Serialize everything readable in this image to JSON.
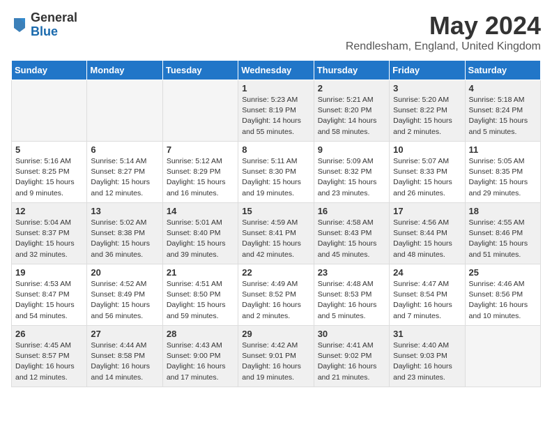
{
  "header": {
    "logo_general": "General",
    "logo_blue": "Blue",
    "title": "May 2024",
    "location": "Rendlesham, England, United Kingdom"
  },
  "weekdays": [
    "Sunday",
    "Monday",
    "Tuesday",
    "Wednesday",
    "Thursday",
    "Friday",
    "Saturday"
  ],
  "weeks": [
    [
      {
        "day": "",
        "empty": true
      },
      {
        "day": "",
        "empty": true
      },
      {
        "day": "",
        "empty": true
      },
      {
        "day": "1",
        "info": "Sunrise: 5:23 AM\nSunset: 8:19 PM\nDaylight: 14 hours\nand 55 minutes."
      },
      {
        "day": "2",
        "info": "Sunrise: 5:21 AM\nSunset: 8:20 PM\nDaylight: 14 hours\nand 58 minutes."
      },
      {
        "day": "3",
        "info": "Sunrise: 5:20 AM\nSunset: 8:22 PM\nDaylight: 15 hours\nand 2 minutes."
      },
      {
        "day": "4",
        "info": "Sunrise: 5:18 AM\nSunset: 8:24 PM\nDaylight: 15 hours\nand 5 minutes."
      }
    ],
    [
      {
        "day": "5",
        "info": "Sunrise: 5:16 AM\nSunset: 8:25 PM\nDaylight: 15 hours\nand 9 minutes."
      },
      {
        "day": "6",
        "info": "Sunrise: 5:14 AM\nSunset: 8:27 PM\nDaylight: 15 hours\nand 12 minutes."
      },
      {
        "day": "7",
        "info": "Sunrise: 5:12 AM\nSunset: 8:29 PM\nDaylight: 15 hours\nand 16 minutes."
      },
      {
        "day": "8",
        "info": "Sunrise: 5:11 AM\nSunset: 8:30 PM\nDaylight: 15 hours\nand 19 minutes."
      },
      {
        "day": "9",
        "info": "Sunrise: 5:09 AM\nSunset: 8:32 PM\nDaylight: 15 hours\nand 23 minutes."
      },
      {
        "day": "10",
        "info": "Sunrise: 5:07 AM\nSunset: 8:33 PM\nDaylight: 15 hours\nand 26 minutes."
      },
      {
        "day": "11",
        "info": "Sunrise: 5:05 AM\nSunset: 8:35 PM\nDaylight: 15 hours\nand 29 minutes."
      }
    ],
    [
      {
        "day": "12",
        "info": "Sunrise: 5:04 AM\nSunset: 8:37 PM\nDaylight: 15 hours\nand 32 minutes."
      },
      {
        "day": "13",
        "info": "Sunrise: 5:02 AM\nSunset: 8:38 PM\nDaylight: 15 hours\nand 36 minutes."
      },
      {
        "day": "14",
        "info": "Sunrise: 5:01 AM\nSunset: 8:40 PM\nDaylight: 15 hours\nand 39 minutes."
      },
      {
        "day": "15",
        "info": "Sunrise: 4:59 AM\nSunset: 8:41 PM\nDaylight: 15 hours\nand 42 minutes."
      },
      {
        "day": "16",
        "info": "Sunrise: 4:58 AM\nSunset: 8:43 PM\nDaylight: 15 hours\nand 45 minutes."
      },
      {
        "day": "17",
        "info": "Sunrise: 4:56 AM\nSunset: 8:44 PM\nDaylight: 15 hours\nand 48 minutes."
      },
      {
        "day": "18",
        "info": "Sunrise: 4:55 AM\nSunset: 8:46 PM\nDaylight: 15 hours\nand 51 minutes."
      }
    ],
    [
      {
        "day": "19",
        "info": "Sunrise: 4:53 AM\nSunset: 8:47 PM\nDaylight: 15 hours\nand 54 minutes."
      },
      {
        "day": "20",
        "info": "Sunrise: 4:52 AM\nSunset: 8:49 PM\nDaylight: 15 hours\nand 56 minutes."
      },
      {
        "day": "21",
        "info": "Sunrise: 4:51 AM\nSunset: 8:50 PM\nDaylight: 15 hours\nand 59 minutes."
      },
      {
        "day": "22",
        "info": "Sunrise: 4:49 AM\nSunset: 8:52 PM\nDaylight: 16 hours\nand 2 minutes."
      },
      {
        "day": "23",
        "info": "Sunrise: 4:48 AM\nSunset: 8:53 PM\nDaylight: 16 hours\nand 5 minutes."
      },
      {
        "day": "24",
        "info": "Sunrise: 4:47 AM\nSunset: 8:54 PM\nDaylight: 16 hours\nand 7 minutes."
      },
      {
        "day": "25",
        "info": "Sunrise: 4:46 AM\nSunset: 8:56 PM\nDaylight: 16 hours\nand 10 minutes."
      }
    ],
    [
      {
        "day": "26",
        "info": "Sunrise: 4:45 AM\nSunset: 8:57 PM\nDaylight: 16 hours\nand 12 minutes."
      },
      {
        "day": "27",
        "info": "Sunrise: 4:44 AM\nSunset: 8:58 PM\nDaylight: 16 hours\nand 14 minutes."
      },
      {
        "day": "28",
        "info": "Sunrise: 4:43 AM\nSunset: 9:00 PM\nDaylight: 16 hours\nand 17 minutes."
      },
      {
        "day": "29",
        "info": "Sunrise: 4:42 AM\nSunset: 9:01 PM\nDaylight: 16 hours\nand 19 minutes."
      },
      {
        "day": "30",
        "info": "Sunrise: 4:41 AM\nSunset: 9:02 PM\nDaylight: 16 hours\nand 21 minutes."
      },
      {
        "day": "31",
        "info": "Sunrise: 4:40 AM\nSunset: 9:03 PM\nDaylight: 16 hours\nand 23 minutes."
      },
      {
        "day": "",
        "empty": true
      }
    ]
  ]
}
